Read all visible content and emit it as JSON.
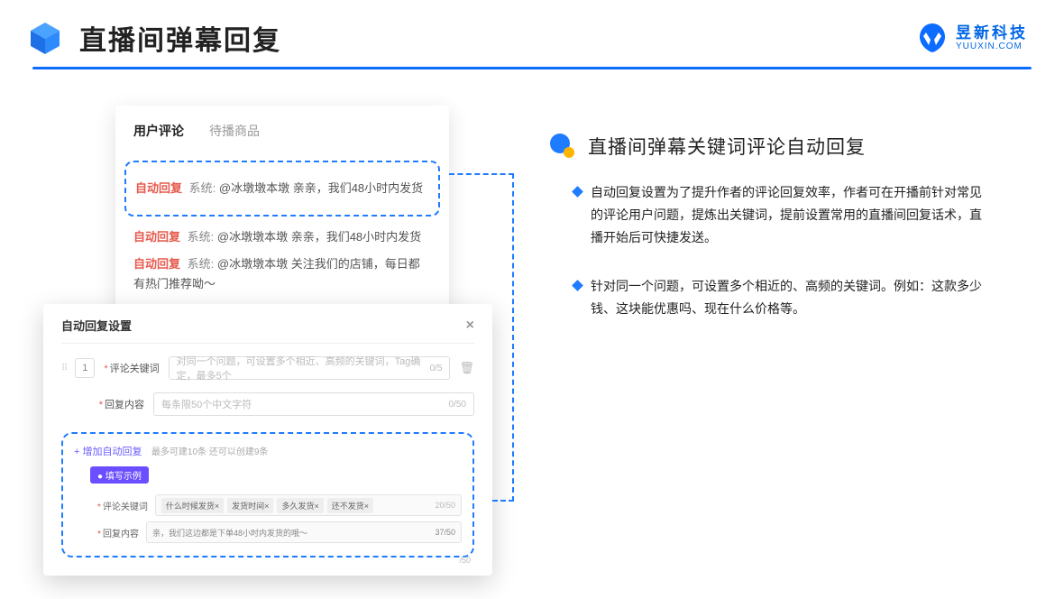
{
  "page_title": "直播间弹幕回复",
  "brand": {
    "name": "昱新科技",
    "url": "YUUXIN.COM"
  },
  "comments": {
    "tabs": [
      "用户评论",
      "待播商品"
    ],
    "list": [
      {
        "badge": "自动回复",
        "sys": "系统:",
        "text": "@冰墩墩本墩 亲亲，我们48小时内发货"
      },
      {
        "badge": "自动回复",
        "sys": "系统:",
        "text": "@冰墩墩本墩 亲亲，我们48小时内发货"
      },
      {
        "badge": "自动回复",
        "sys": "系统:",
        "text": "@冰墩墩本墩 关注我们的店铺，每日都有热门推荐呦～"
      }
    ]
  },
  "settings": {
    "title": "自动回复设置",
    "index": "1",
    "keyword_label": "评论关键词",
    "keyword_placeholder": "对同一个问题，可设置多个相近、高频的关键词，Tag确定，最多5个",
    "keyword_count": "0/5",
    "content_label": "回复内容",
    "content_placeholder": "每条限50个中文字符",
    "content_count": "0/50",
    "add_link": "+ 增加自动回复",
    "add_sub": "最多可建10条 还可以创建9条",
    "example_pill": "● 填写示例",
    "ex_keyword_label": "评论关键词",
    "ex_chips": [
      "什么时候发货×",
      "发货时间×",
      "多久发货×",
      "还不发货×"
    ],
    "ex_keyword_count": "20/50",
    "ex_content_label": "回复内容",
    "ex_content_value": "亲，我们这边都是下单48小时内发货的哦～",
    "ex_content_count": "37/50",
    "stray_count": "/50"
  },
  "right": {
    "section_title": "直播间弹幕关键词评论自动回复",
    "bullets": [
      "自动回复设置为了提升作者的评论回复效率，作者可在开播前针对常见的评论用户问题，提炼出关键词，提前设置常用的直播间回复话术，直播开始后可快捷发送。",
      "针对同一个问题，可设置多个相近的、高频的关键词。例如：这款多少钱、这块能优惠吗、现在什么价格等。"
    ]
  }
}
